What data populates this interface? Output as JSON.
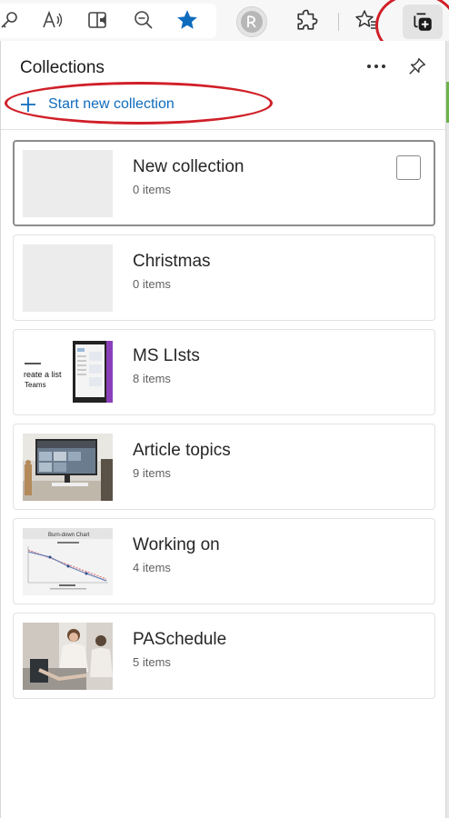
{
  "toolbar": {
    "icons": [
      "key-icon",
      "read-aloud-icon",
      "immersive-reader-icon",
      "zoom-out-icon",
      "favorite-star-filled-icon",
      "profile-avatar",
      "extensions-icon",
      "favorites-icon",
      "collections-icon"
    ],
    "accent": "#0f6cbd"
  },
  "panel": {
    "title": "Collections",
    "start_new_label": "Start new collection",
    "collections": [
      {
        "name": "New collection",
        "count": "0 items",
        "thumb": "empty",
        "selected": true
      },
      {
        "name": "Christmas",
        "count": "0 items",
        "thumb": "empty"
      },
      {
        "name": "MS LIsts",
        "count": "8 items",
        "thumb": "ms-lists-screenshot"
      },
      {
        "name": "Article topics",
        "count": "9 items",
        "thumb": "desk-computer-photo"
      },
      {
        "name": "Working on",
        "count": "4 items",
        "thumb": "burndown-chart-slide"
      },
      {
        "name": "PASchedule",
        "count": "5 items",
        "thumb": "office-people-photo"
      }
    ]
  },
  "thumb_text": {
    "ms_lists_line1": "reate a list",
    "ms_lists_line2": "Teams",
    "burndown_title": "Burn-down Chart"
  },
  "annotation_color": "#d01f28"
}
